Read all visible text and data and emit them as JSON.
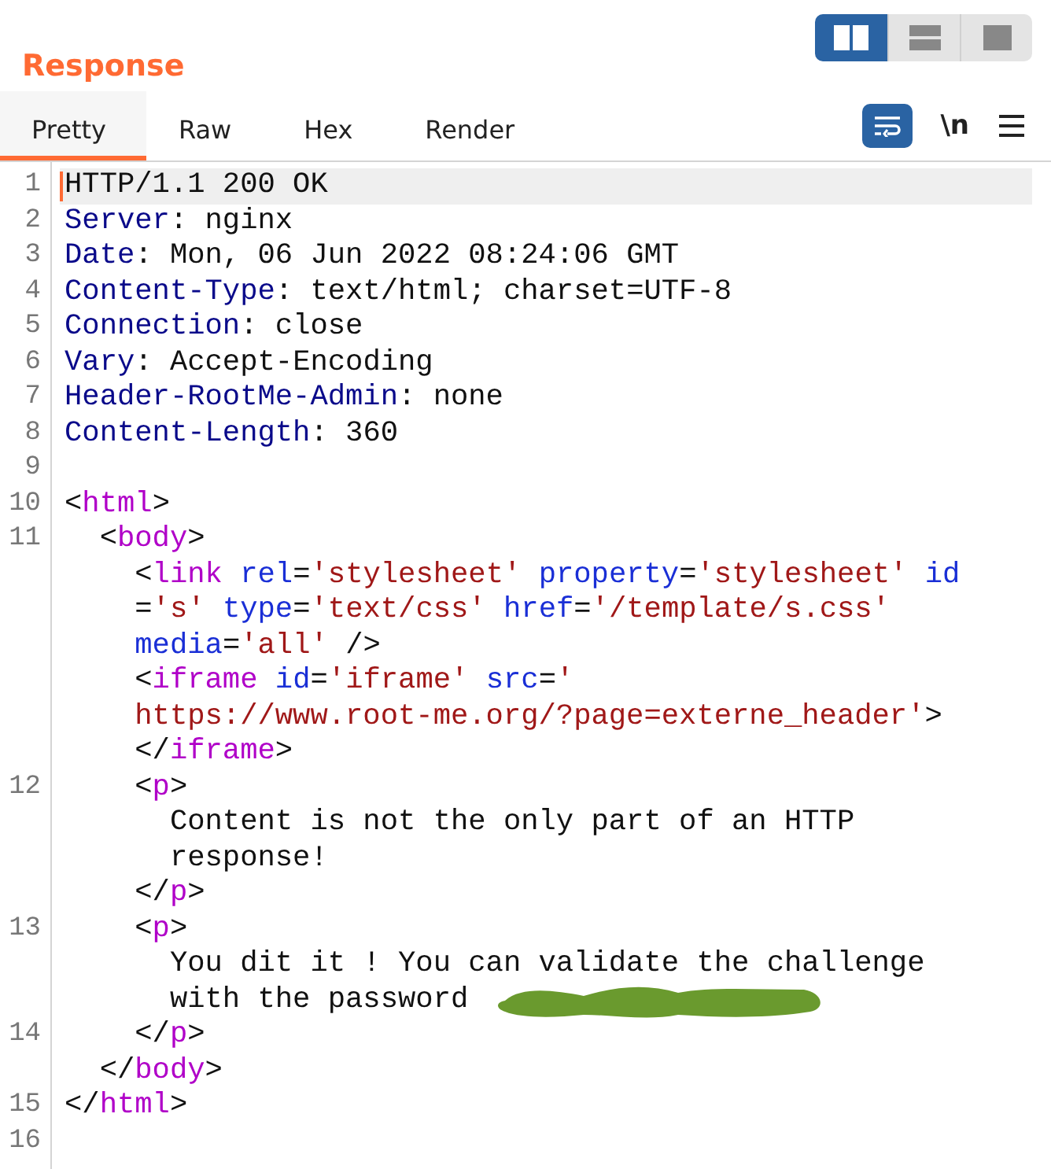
{
  "panel": {
    "title": "Response",
    "layout_options": [
      {
        "kind": "columns",
        "selected": true
      },
      {
        "kind": "rows",
        "selected": false
      },
      {
        "kind": "single",
        "selected": false
      }
    ]
  },
  "tabs": [
    {
      "label": "Pretty",
      "selected": true
    },
    {
      "label": "Raw",
      "selected": false
    },
    {
      "label": "Hex",
      "selected": false
    },
    {
      "label": "Render",
      "selected": false
    }
  ],
  "toolbar": {
    "wrap_lines": {
      "selected": true
    },
    "newline_toggle": {
      "label": "\\n",
      "selected": false
    }
  },
  "editor": {
    "lines": [
      {
        "number": "1",
        "current": true,
        "rows": [
          {
            "tokens": [
              {
                "kind": "plain",
                "text": "HTTP/1.1 200 OK"
              }
            ]
          }
        ]
      },
      {
        "number": "2",
        "current": false,
        "rows": [
          {
            "tokens": [
              {
                "kind": "header",
                "text": "Server"
              },
              {
                "kind": "plain",
                "text": ": nginx"
              }
            ]
          }
        ]
      },
      {
        "number": "3",
        "current": false,
        "rows": [
          {
            "tokens": [
              {
                "kind": "header",
                "text": "Date"
              },
              {
                "kind": "plain",
                "text": ": Mon, 06 Jun 2022 08:24:06 GMT"
              }
            ]
          }
        ]
      },
      {
        "number": "4",
        "current": false,
        "rows": [
          {
            "tokens": [
              {
                "kind": "header",
                "text": "Content-Type"
              },
              {
                "kind": "plain",
                "text": ": text/html; charset=UTF-8"
              }
            ]
          }
        ]
      },
      {
        "number": "5",
        "current": false,
        "rows": [
          {
            "tokens": [
              {
                "kind": "header",
                "text": "Connection"
              },
              {
                "kind": "plain",
                "text": ": close"
              }
            ]
          }
        ]
      },
      {
        "number": "6",
        "current": false,
        "rows": [
          {
            "tokens": [
              {
                "kind": "header",
                "text": "Vary"
              },
              {
                "kind": "plain",
                "text": ": Accept-Encoding"
              }
            ]
          }
        ]
      },
      {
        "number": "7",
        "current": false,
        "rows": [
          {
            "tokens": [
              {
                "kind": "header",
                "text": "Header-RootMe-Admin"
              },
              {
                "kind": "plain",
                "text": ": none"
              }
            ]
          }
        ]
      },
      {
        "number": "8",
        "current": false,
        "rows": [
          {
            "tokens": [
              {
                "kind": "header",
                "text": "Content-Length"
              },
              {
                "kind": "plain",
                "text": ": 360"
              }
            ]
          }
        ]
      },
      {
        "number": "9",
        "current": false,
        "rows": [
          {
            "tokens": []
          }
        ]
      },
      {
        "number": "10",
        "current": false,
        "rows": [
          {
            "tokens": [
              {
                "kind": "plain",
                "text": "<"
              },
              {
                "kind": "tag",
                "text": "html"
              },
              {
                "kind": "plain",
                "text": ">"
              }
            ]
          }
        ]
      },
      {
        "number": "11",
        "current": false,
        "rows": [
          {
            "tokens": [
              {
                "kind": "plain",
                "text": "  <"
              },
              {
                "kind": "tag",
                "text": "body"
              },
              {
                "kind": "plain",
                "text": ">"
              }
            ]
          },
          {
            "tokens": [
              {
                "kind": "plain",
                "text": "    <"
              },
              {
                "kind": "tag",
                "text": "link"
              },
              {
                "kind": "attr",
                "text": " rel"
              },
              {
                "kind": "plain",
                "text": "="
              },
              {
                "kind": "value",
                "text": "'stylesheet'"
              },
              {
                "kind": "attr",
                "text": " property"
              },
              {
                "kind": "plain",
                "text": "="
              },
              {
                "kind": "value",
                "text": "'stylesheet'"
              },
              {
                "kind": "attr",
                "text": " id"
              }
            ]
          },
          {
            "tokens": [
              {
                "kind": "plain",
                "text": "    ="
              },
              {
                "kind": "value",
                "text": "'s'"
              },
              {
                "kind": "attr",
                "text": " type"
              },
              {
                "kind": "plain",
                "text": "="
              },
              {
                "kind": "value",
                "text": "'text/css'"
              },
              {
                "kind": "attr",
                "text": " href"
              },
              {
                "kind": "plain",
                "text": "="
              },
              {
                "kind": "value",
                "text": "'/template/s.css'"
              }
            ]
          },
          {
            "tokens": [
              {
                "kind": "attr",
                "text": "    media"
              },
              {
                "kind": "plain",
                "text": "="
              },
              {
                "kind": "value",
                "text": "'all'"
              },
              {
                "kind": "plain",
                "text": " />"
              }
            ]
          },
          {
            "tokens": [
              {
                "kind": "plain",
                "text": "    <"
              },
              {
                "kind": "tag",
                "text": "iframe"
              },
              {
                "kind": "attr",
                "text": " id"
              },
              {
                "kind": "plain",
                "text": "="
              },
              {
                "kind": "value",
                "text": "'iframe'"
              },
              {
                "kind": "attr",
                "text": " src"
              },
              {
                "kind": "plain",
                "text": "="
              },
              {
                "kind": "value",
                "text": "'"
              }
            ]
          },
          {
            "tokens": [
              {
                "kind": "value",
                "text": "    https://www.root-me.org/?page=externe_header'"
              },
              {
                "kind": "plain",
                "text": ">"
              }
            ]
          },
          {
            "tokens": [
              {
                "kind": "plain",
                "text": "    </"
              },
              {
                "kind": "tag",
                "text": "iframe"
              },
              {
                "kind": "plain",
                "text": ">"
              }
            ]
          }
        ]
      },
      {
        "number": "12",
        "current": false,
        "rows": [
          {
            "tokens": [
              {
                "kind": "plain",
                "text": "    <"
              },
              {
                "kind": "tag",
                "text": "p"
              },
              {
                "kind": "plain",
                "text": ">"
              }
            ]
          },
          {
            "tokens": [
              {
                "kind": "plain",
                "text": "      Content is not the only part of an HTTP"
              }
            ]
          },
          {
            "tokens": [
              {
                "kind": "plain",
                "text": "      response!"
              }
            ]
          },
          {
            "tokens": [
              {
                "kind": "plain",
                "text": "    </"
              },
              {
                "kind": "tag",
                "text": "p"
              },
              {
                "kind": "plain",
                "text": ">"
              }
            ]
          }
        ]
      },
      {
        "number": "13",
        "current": false,
        "rows": [
          {
            "tokens": [
              {
                "kind": "plain",
                "text": "    <"
              },
              {
                "kind": "tag",
                "text": "p"
              },
              {
                "kind": "plain",
                "text": ">"
              }
            ]
          },
          {
            "tokens": [
              {
                "kind": "plain",
                "text": "      You dit it ! You can validate the challenge"
              }
            ]
          },
          {
            "tokens": [
              {
                "kind": "plain",
                "text": "      with the password "
              },
              {
                "kind": "redaction"
              }
            ]
          }
        ]
      },
      {
        "number": "14",
        "current": false,
        "rows": [
          {
            "tokens": [
              {
                "kind": "plain",
                "text": "    </"
              },
              {
                "kind": "tag",
                "text": "p"
              },
              {
                "kind": "plain",
                "text": ">"
              }
            ]
          },
          {
            "tokens": [
              {
                "kind": "plain",
                "text": "  </"
              },
              {
                "kind": "tag",
                "text": "body"
              },
              {
                "kind": "plain",
                "text": ">"
              }
            ]
          }
        ]
      },
      {
        "number": "15",
        "current": false,
        "rows": [
          {
            "tokens": [
              {
                "kind": "plain",
                "text": "</"
              },
              {
                "kind": "tag",
                "text": "html"
              },
              {
                "kind": "plain",
                "text": ">"
              }
            ]
          }
        ]
      },
      {
        "number": "16",
        "current": false,
        "rows": [
          {
            "tokens": []
          }
        ]
      }
    ]
  }
}
